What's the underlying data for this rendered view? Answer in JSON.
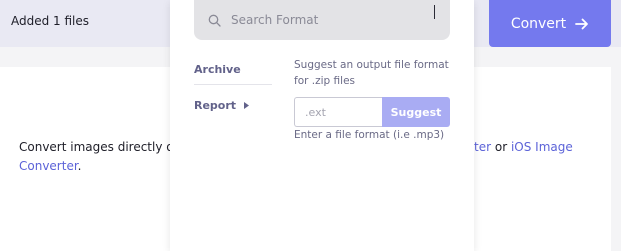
{
  "header": {
    "added_files": "Added 1 files",
    "convert_label": "Convert"
  },
  "content": {
    "text_left": "Convert images directly or",
    "link_converter_suffix": "ter",
    "text_or": "or",
    "link_ios_line1": "iOS Image",
    "link_ios_line2": "Converter",
    "period": "."
  },
  "format_dropdown": {
    "search_placeholder": "Search Format",
    "categories": [
      {
        "label": "Archive"
      },
      {
        "label": "Report"
      }
    ],
    "suggest_hint": "Suggest an output file format for .zip files",
    "ext_placeholder": ".ext",
    "suggest_label": "Suggest",
    "ext_help": "Enter a file format (i.e .mp3)"
  },
  "colors": {
    "accent": "#7479ee",
    "accent_light": "#a9acf3",
    "link": "#5c63d8",
    "topbar_bg": "#e9e9f3"
  },
  "icons": {
    "search": "search-icon",
    "convert_arrow": "arrow-right-icon",
    "report_chevron": "caret-right-icon"
  }
}
